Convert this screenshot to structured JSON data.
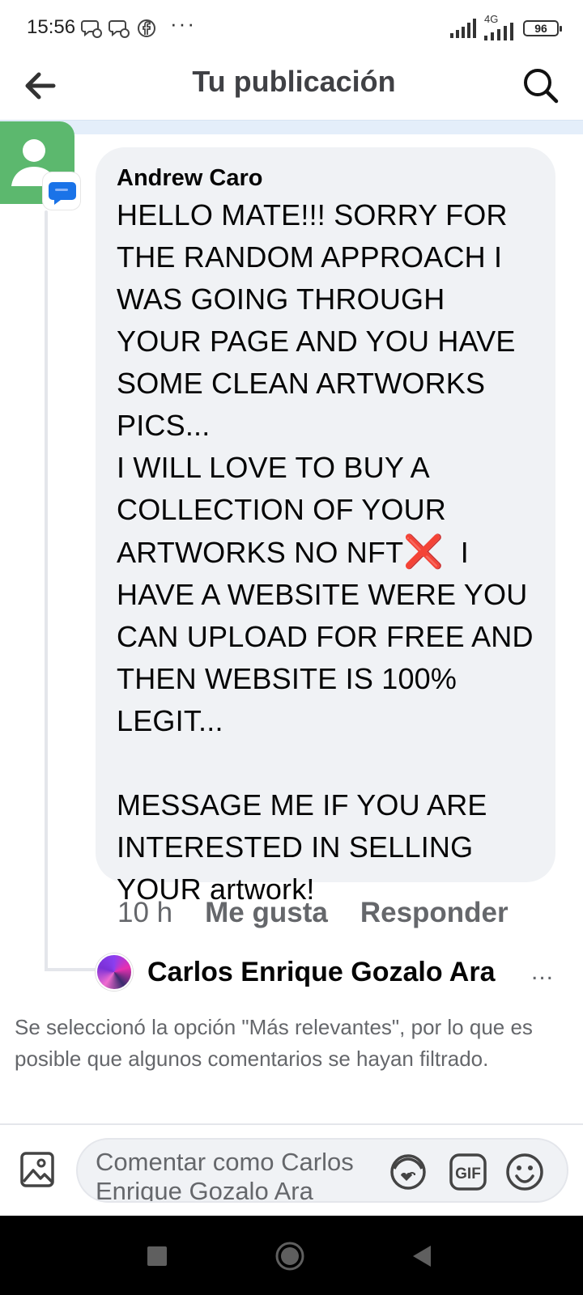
{
  "status_bar": {
    "time": "15:56",
    "dots": "···",
    "network": "4G",
    "battery": "96"
  },
  "header": {
    "title": "Tu publicación"
  },
  "comment": {
    "author": "Andrew Caro",
    "text_before_x": "HELLO MATE!!! SORRY FOR THE RANDOM APPROACH I WAS GOING THROUGH YOUR PAGE AND YOU HAVE SOME CLEAN ARTWORKS PICS...\nI WILL LOVE TO BUY A COLLECTION OF YOUR ARTWORKS NO NFT",
    "x_emoji": "❌",
    "text_after_x": "  I HAVE A WEBSITE WERE YOU CAN UPLOAD FOR FREE AND THEN WEBSITE IS 100% LEGIT...\n\nMESSAGE ME IF YOU ARE INTERESTED IN SELLING YOUR artwork!",
    "time": "10 h",
    "like_label": "Me gusta",
    "reply_label": "Responder"
  },
  "reply": {
    "name": "Carlos Enrique Gozalo Ara",
    "more": "..."
  },
  "notice": "Se seleccionó la opción \"Más relevantes\", por lo que es posible que algunos comentarios se hayan filtrado.",
  "composer": {
    "placeholder": "Comentar como Carlos Enrique Gozalo Ara"
  },
  "icons": {
    "back": "arrow-left-icon",
    "search": "search-icon",
    "photo": "photo-icon",
    "avatar_sticker": "sticker-icon",
    "gif": "gif-icon",
    "emoji": "emoji-icon"
  },
  "colors": {
    "bubble": "#f0f2f5",
    "secondary_text": "#65676b",
    "avatar_green": "#5cb86e",
    "badge_blue": "#1a73e8"
  }
}
